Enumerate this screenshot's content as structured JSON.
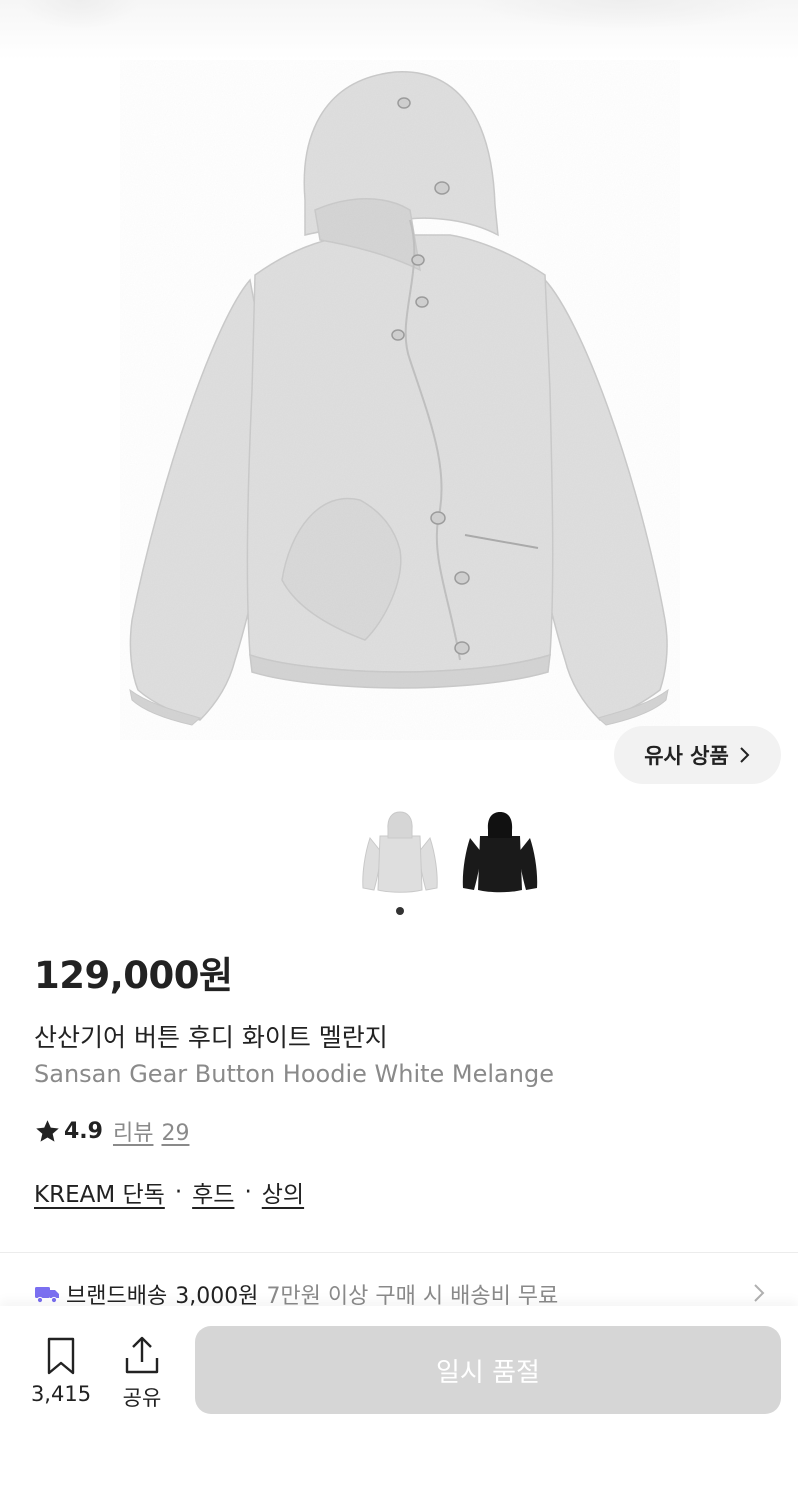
{
  "similar_button": {
    "label": "유사 상품"
  },
  "product": {
    "price": "129,000원",
    "name_ko": "산산기어 버튼 후디 화이트 멜란지",
    "name_en": "Sansan Gear Button Hoodie White Melange",
    "rating": "4.9",
    "review_label": "리뷰",
    "review_count": "29",
    "tags": [
      "KREAM 단독",
      "후드",
      "상의"
    ],
    "tag_separator": "·"
  },
  "shipping": {
    "label": "브랜드배송",
    "price": "3,000원",
    "note": "7만원 이상 구매 시 배송비 무료"
  },
  "bottom_bar": {
    "bookmark_count": "3,415",
    "share_label": "공유",
    "buy_button_label": "일시 품절"
  },
  "colors": {
    "hoodie_main": "#dedede",
    "hoodie_alt": "#1a1a1a",
    "soldout_button": "#d6d6d6",
    "truck_icon": "#7a6ff0"
  },
  "icons": [
    "chevron-right-icon",
    "star-icon",
    "truck-icon",
    "bookmark-icon",
    "share-icon"
  ],
  "carousel": {
    "active_index": 0,
    "count": 2
  }
}
